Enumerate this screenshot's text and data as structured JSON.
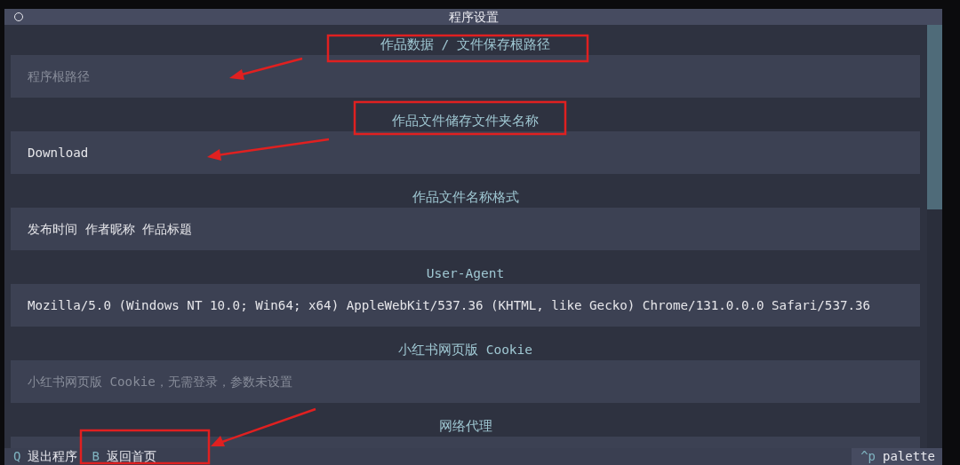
{
  "window": {
    "title": "程序设置"
  },
  "settings": [
    {
      "label": "作品数据 / 文件保存根路径",
      "placeholder": "程序根路径"
    },
    {
      "label": "作品文件储存文件夹名称",
      "value": "Download"
    },
    {
      "label": "作品文件名称格式",
      "value": "发布时间 作者昵称 作品标题"
    },
    {
      "label": "User-Agent",
      "value": "Mozilla/5.0 (Windows NT 10.0; Win64; x64) AppleWebKit/537.36 (KHTML, like Gecko) Chrome/131.0.0.0 Safari/537.36"
    },
    {
      "label": "小红书网页版 Cookie",
      "placeholder": "小红书网页版 Cookie，无需登录，参数未设置"
    },
    {
      "label": "网络代理"
    }
  ],
  "footer": {
    "bindings": [
      {
        "key": "Q",
        "action": "退出程序"
      },
      {
        "key": "B",
        "action": "返回首页"
      }
    ],
    "palette": {
      "key": "^p",
      "action": "palette"
    }
  }
}
